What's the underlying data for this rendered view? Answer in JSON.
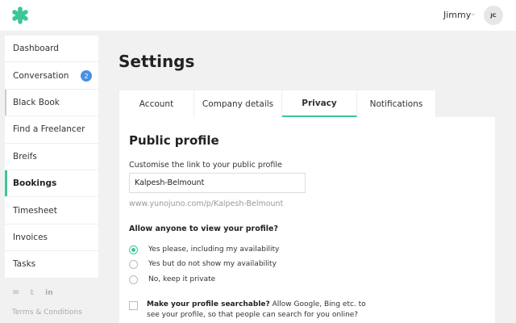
{
  "header": {
    "user_name": "Jimmy",
    "avatar_initials": "JC",
    "brand_color": "#3cc69a"
  },
  "sidebar": {
    "items": [
      {
        "label": "Dashboard"
      },
      {
        "label": "Conversation",
        "badge": "2"
      },
      {
        "label": "Black Book"
      },
      {
        "label": "Find a Freelancer"
      },
      {
        "label": "Breifs"
      },
      {
        "label": "Bookings"
      },
      {
        "label": "Timesheet"
      },
      {
        "label": "Invoices"
      },
      {
        "label": "Tasks"
      }
    ],
    "active": "Bookings",
    "social_icons": [
      "email-icon",
      "twitter-icon",
      "linkedin-icon"
    ],
    "footer_link": "Terms & Conditions"
  },
  "main": {
    "title": "Settings",
    "tabs": [
      {
        "label": "Account"
      },
      {
        "label": "Company details"
      },
      {
        "label": "Privacy"
      },
      {
        "label": "Notifications"
      }
    ],
    "active_tab": "Privacy"
  },
  "privacy": {
    "section_title": "Public profile",
    "link_label": "Customise the link to your public profile",
    "link_value": "Kalpesh-Belmount",
    "url_preview": "www.yunojuno.com/p/Kalpesh-Belmount",
    "visibility_question": "Allow anyone to view your profile?",
    "options": [
      {
        "label": "Yes please, including my availability",
        "selected": true
      },
      {
        "label": "Yes but do not show my availability",
        "selected": false
      },
      {
        "label": "No, keep it private",
        "selected": false
      }
    ],
    "searchable_bold": "Make your profile searchable?",
    "searchable_text": " Allow Google, Bing etc. to see your profile, so that people can search for you online?",
    "searchable_checked": false
  }
}
